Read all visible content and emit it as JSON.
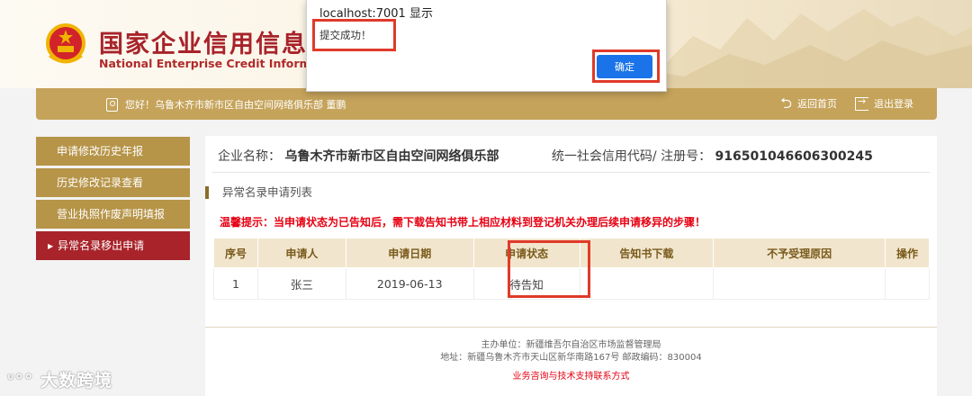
{
  "header": {
    "title_cn": "国家企业信用信息",
    "title_en": "National Enterprise Credit Informatio"
  },
  "userbar": {
    "greeting": "您好！乌鲁木齐市新市区自由空间网络俱乐部  董鹏",
    "home_label": "返回首页",
    "logout_label": "退出登录"
  },
  "sidebar": {
    "items": [
      {
        "label": "申请修改历史年报"
      },
      {
        "label": "历史修改记录查看"
      },
      {
        "label": "营业执照作废声明填报"
      },
      {
        "label": "异常名录移出申请"
      }
    ]
  },
  "main": {
    "ent_name_label": "企业名称：",
    "ent_name": "乌鲁木齐市新市区自由空间网络俱乐部",
    "code_label": "统一社会信用代码/ 注册号：",
    "code": "916501046606300245",
    "section_title": "异常名录申请列表",
    "tip": "温馨提示：当申请状态为已告知后，需下载告知书带上相应材料到登记机关办理后续申请移异的步骤！",
    "table": {
      "headers": [
        "序号",
        "申请人",
        "申请日期",
        "申请状态",
        "告知书下载",
        "不予受理原因",
        "操作"
      ],
      "rows": [
        [
          "1",
          "张三",
          "2019-06-13",
          "待告知",
          "",
          "",
          ""
        ]
      ]
    }
  },
  "footer": {
    "sponsor": "主办单位：新疆维吾尔自治区市场监督管理局",
    "address": "地址：新疆乌鲁木齐市天山区新华南路167号   邮政编码：830004",
    "contact": "业务咨询与技术支持联系方式"
  },
  "dialog": {
    "origin": "localhost:7001 显示",
    "message": "提交成功！",
    "ok_label": "确定"
  },
  "watermark": "大数跨境",
  "colors": {
    "gold": "#c5a35a",
    "sidebar": "#b69448",
    "active": "#a8232a",
    "highlight": "#e03a2a",
    "accent_blue": "#1a73e8"
  }
}
